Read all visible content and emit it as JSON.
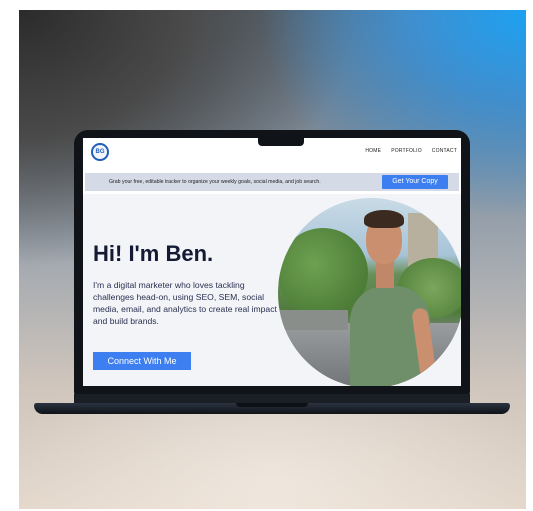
{
  "site": {
    "logo_text": "BG",
    "nav": [
      "HOME",
      "PORTFOLIO",
      "CONTACT"
    ]
  },
  "banner": {
    "text": "Grab your free, editable tracker to organize your weekly goals, social media, and job search.",
    "button": "Get Your Copy"
  },
  "hero": {
    "title": "Hi! I'm Ben.",
    "description": "I'm a digital marketer who loves tackling challenges head-on, using SEO, SEM, social media, email, and analytics to create real impact and build brands.",
    "button": "Connect With Me"
  },
  "colors": {
    "accent": "#3d7ff0",
    "heading": "#141a33",
    "banner_bg": "#d4dbe6"
  }
}
